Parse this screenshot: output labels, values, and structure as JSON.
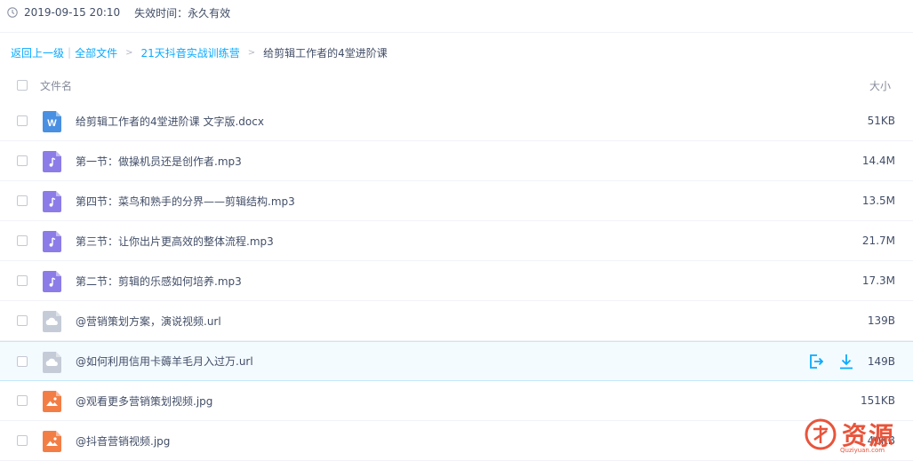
{
  "meta": {
    "datetime": "2019-09-15 20:10",
    "expire": "失效时间：永久有效"
  },
  "breadcrumb": {
    "back": "返回上一级",
    "bar": "|",
    "all_files": "全部文件",
    "folder": "21天抖音实战训练营",
    "current": "给剪辑工作者的4堂进阶课"
  },
  "table_head": {
    "name": "文件名",
    "size": "大小"
  },
  "files": [
    {
      "name": "给剪辑工作者的4堂进阶课 文字版.docx",
      "size": "51KB",
      "type": "word"
    },
    {
      "name": "第一节：做操机员还是创作者.mp3",
      "size": "14.4M",
      "type": "audio"
    },
    {
      "name": "第四节：菜鸟和熟手的分界——剪辑结构.mp3",
      "size": "13.5M",
      "type": "audio"
    },
    {
      "name": "第三节：让你出片更高效的整体流程.mp3",
      "size": "21.7M",
      "type": "audio"
    },
    {
      "name": "第二节：剪辑的乐感如何培养.mp3",
      "size": "17.3M",
      "type": "audio"
    },
    {
      "name": "@营销策划方案，演说视频.url",
      "size": "139B",
      "type": "url"
    },
    {
      "name": "@如何利用信用卡薅羊毛月入过万.url",
      "size": "149B",
      "type": "url"
    },
    {
      "name": "@观看更多营销策划视频.jpg",
      "size": "151KB",
      "type": "image"
    },
    {
      "name": "@抖音营销视频.jpg",
      "size": "40KB",
      "type": "image"
    }
  ],
  "icons": {
    "word": "word-file-icon",
    "audio": "music-file-icon",
    "url": "cloud-link-file-icon",
    "image": "image-file-icon"
  },
  "colors": {
    "link": "#09aaff",
    "word": "#4a90e2",
    "audio": "#8c7ce8",
    "url": "#c5ccd8",
    "image": "#f37e45"
  },
  "watermark": {
    "text": "资源",
    "sub": "Quziyuan.com"
  }
}
